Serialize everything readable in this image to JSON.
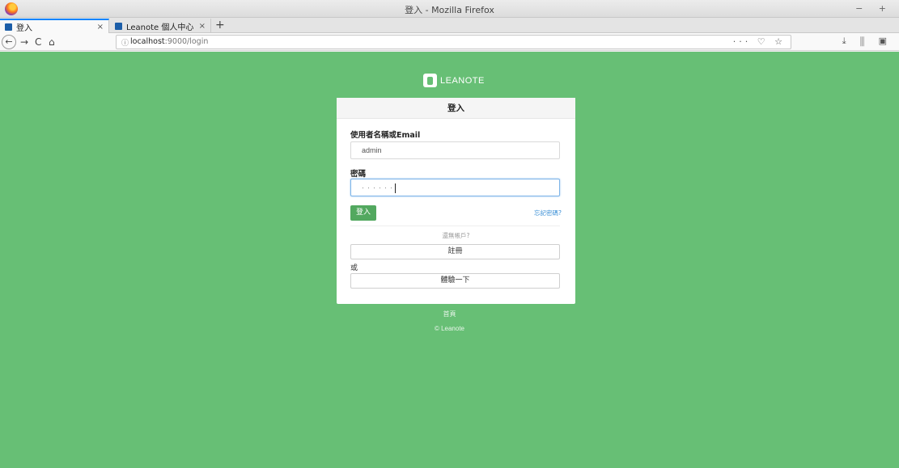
{
  "window": {
    "title": "登入 - Mozilla Firefox",
    "controls": "− +"
  },
  "tabs": [
    {
      "label": "登入",
      "close": "×"
    },
    {
      "label": "Leanote 個人中心",
      "close": "×"
    }
  ],
  "new_tab": "+",
  "nav": {
    "back": "←",
    "forward": "→",
    "reload": "C",
    "home": "⌂",
    "url_info": "ⓘ",
    "url_host": "localhost",
    "url_path": ":9000/login",
    "url_actions": "··· ♡ ☆",
    "right_tools": "⤓ ⫼ ▣"
  },
  "brand": {
    "name": "LEANOTE"
  },
  "login": {
    "heading": "登入",
    "username_label": "使用者名稱或Email",
    "username_value": "admin",
    "password_label": "密碼",
    "password_mask": "······",
    "submit": "登入",
    "forgot": "忘記密碼?",
    "no_account": "還無帳戶?",
    "register": "註冊",
    "or": "或",
    "try": "體驗一下"
  },
  "footer": {
    "home": "首頁",
    "copyright": "© Leanote"
  },
  "colors": {
    "page_bg": "#67bf75",
    "primary_button": "#52a85f",
    "link": "#3a8fd6",
    "tab_accent": "#0a84ff"
  }
}
